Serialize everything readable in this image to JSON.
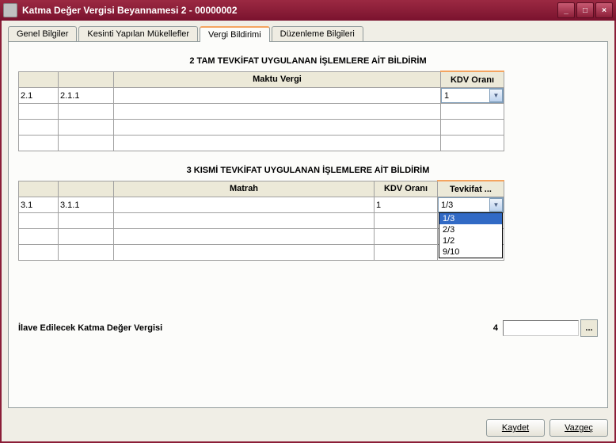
{
  "titlebar": {
    "title": "Katma Değer Vergisi Beyannamesi 2 - 00000002"
  },
  "tabs": {
    "genel": "Genel Bilgiler",
    "kesinti": "Kesinti Yapılan Mükellefler",
    "vergi": "Vergi Bildirimi",
    "duzenleme": "Düzenleme Bilgileri"
  },
  "sec2": {
    "title": "2 TAM TEVKİFAT UYGULANAN İŞLEMLERE AİT BİLDİRİM",
    "hdr_maktu": "Maktu Vergi",
    "hdr_kdv": "KDV Oranı",
    "rows": [
      {
        "a": "2.1",
        "b": "2.1.1",
        "c": "",
        "d": "1"
      },
      {
        "a": "",
        "b": "",
        "c": "",
        "d": ""
      },
      {
        "a": "",
        "b": "",
        "c": "",
        "d": ""
      },
      {
        "a": "",
        "b": "",
        "c": "",
        "d": ""
      }
    ]
  },
  "sec3": {
    "title": "3 KISMİ TEVKİFAT UYGULANAN İŞLEMLERE AİT BİLDİRİM",
    "hdr_matrah": "Matrah",
    "hdr_kdv": "KDV Oranı",
    "hdr_tevkifat": "Tevkifat ...",
    "rows": [
      {
        "a": "3.1",
        "b": "3.1.1",
        "c": "",
        "d": "1",
        "e": "1/3"
      },
      {
        "a": "",
        "b": "",
        "c": "",
        "d": "",
        "e": ""
      },
      {
        "a": "",
        "b": "",
        "c": "",
        "d": "",
        "e": ""
      },
      {
        "a": "",
        "b": "",
        "c": "",
        "d": "",
        "e": ""
      }
    ],
    "options": [
      "1/3",
      "2/3",
      "1/2",
      "9/10"
    ]
  },
  "ilave": {
    "label": "İlave Edilecek Katma Değer Vergisi",
    "num": "4",
    "value": "",
    "more": "..."
  },
  "buttons": {
    "kaydet": "Kaydet",
    "vazgec": "Vazgeç"
  }
}
